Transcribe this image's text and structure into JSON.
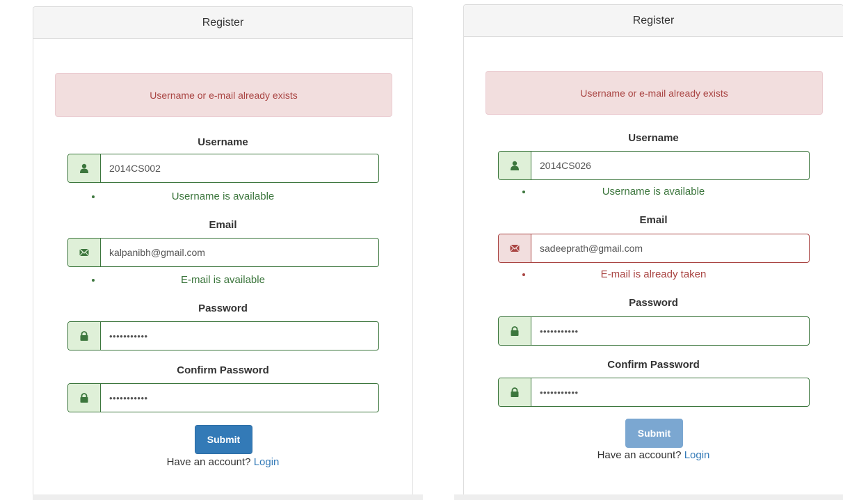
{
  "panels": [
    {
      "heading": "Register",
      "alert": "Username or e-mail already exists",
      "username_label": "Username",
      "username_value": "2014CS002",
      "username_help": "Username is available",
      "email_label": "Email",
      "email_value": "kalpanibh@gmail.com",
      "email_help": "E-mail is available",
      "password_label": "Password",
      "password_value": "•••••••••••",
      "confirm_label": "Confirm Password",
      "confirm_value": "•••••••••••",
      "submit_label": "Submit",
      "account_text": "Have an account?",
      "login_link": "Login"
    },
    {
      "heading": "Register",
      "alert": "Username or e-mail already exists",
      "username_label": "Username",
      "username_value": "2014CS026",
      "username_help": "Username is available",
      "email_label": "Email",
      "email_value": "sadeeprath@gmail.com",
      "email_help": "E-mail is already taken",
      "password_label": "Password",
      "password_value": "•••••••••••",
      "confirm_label": "Confirm Password",
      "confirm_value": "•••••••••••",
      "submit_label": "Submit",
      "account_text": "Have an account?",
      "login_link": "Login"
    }
  ],
  "colors": {
    "success": "#3c763d",
    "error": "#a94442",
    "primary": "#337ab7",
    "alert_bg": "#f2dede"
  }
}
